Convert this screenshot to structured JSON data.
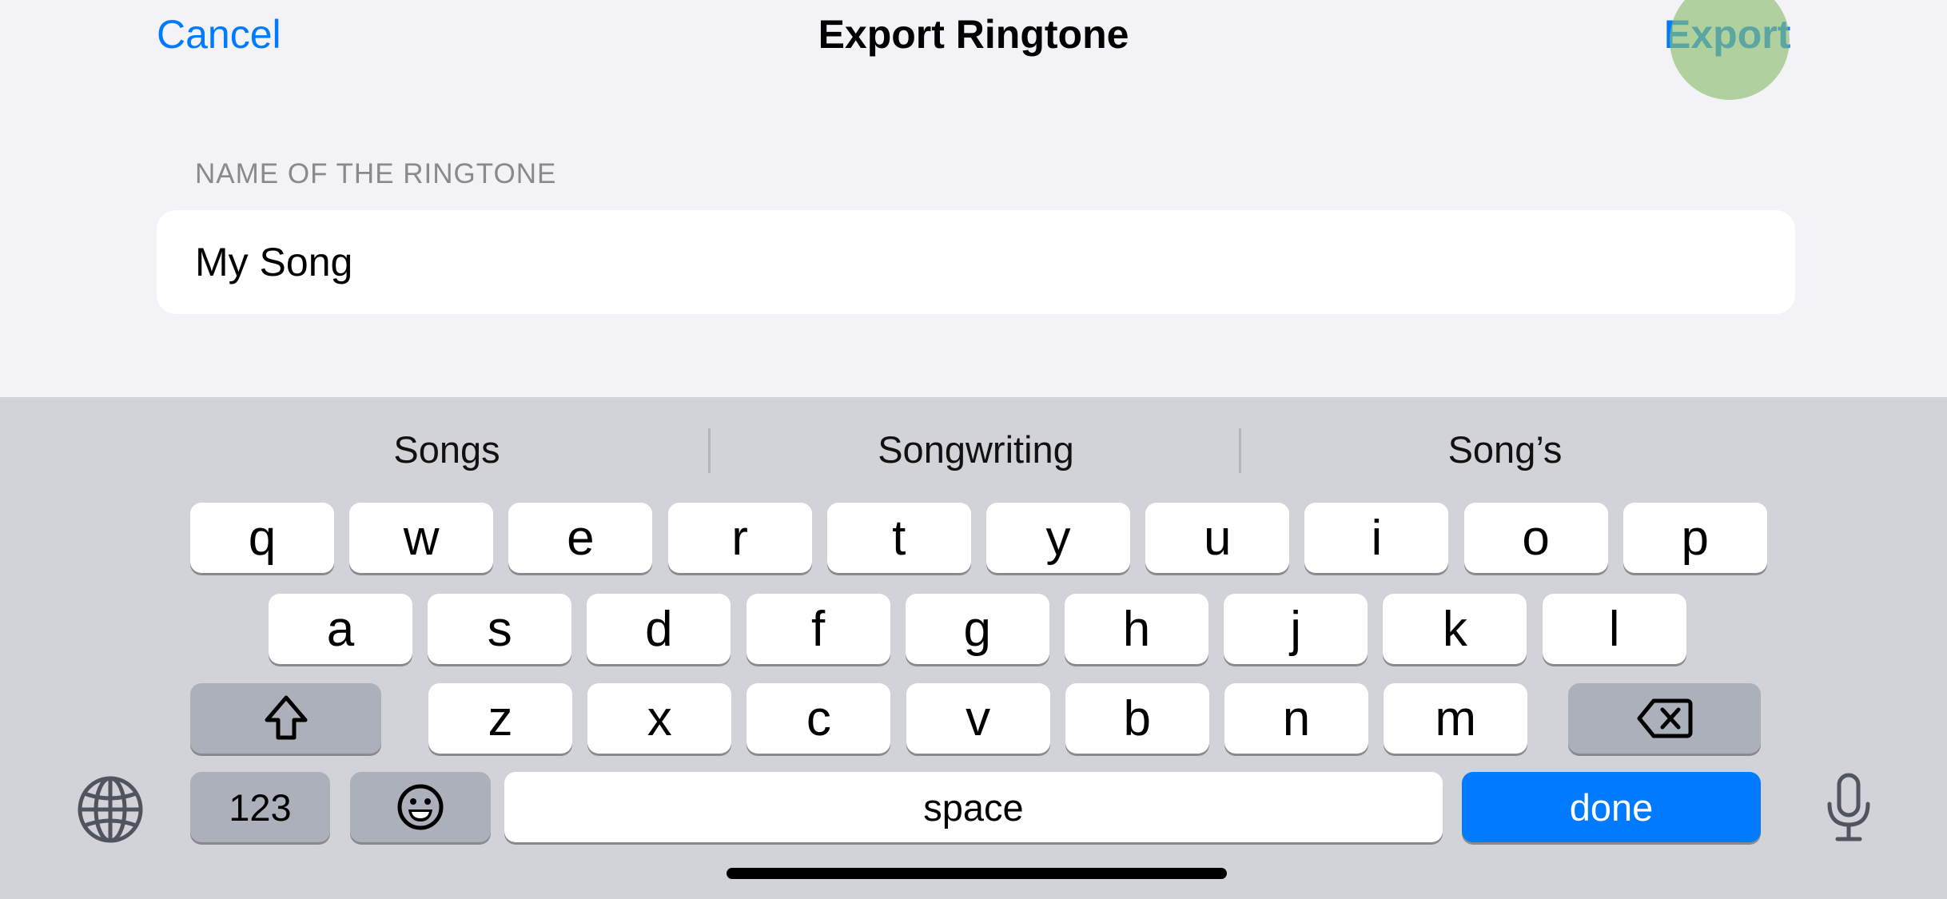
{
  "nav": {
    "cancel": "Cancel",
    "title": "Export Ringtone",
    "export": "Export"
  },
  "form": {
    "label": "NAME OF THE RINGTONE",
    "value": "My Song"
  },
  "keyboard": {
    "suggestions": [
      "Songs",
      "Songwriting",
      "Song’s"
    ],
    "row1": [
      "q",
      "w",
      "e",
      "r",
      "t",
      "y",
      "u",
      "i",
      "o",
      "p"
    ],
    "row2": [
      "a",
      "s",
      "d",
      "f",
      "g",
      "h",
      "j",
      "k",
      "l"
    ],
    "row3": [
      "z",
      "x",
      "c",
      "v",
      "b",
      "n",
      "m"
    ],
    "numbers": "123",
    "space": "space",
    "done": "done",
    "icons": {
      "shift": "shift-icon",
      "delete": "delete-icon",
      "emoji": "emoji-icon",
      "globe": "globe-icon",
      "mic": "microphone-icon"
    }
  },
  "colors": {
    "accent": "#007aff",
    "keyboard_bg": "#d1d3d9",
    "page_bg": "#f2f2f7"
  }
}
